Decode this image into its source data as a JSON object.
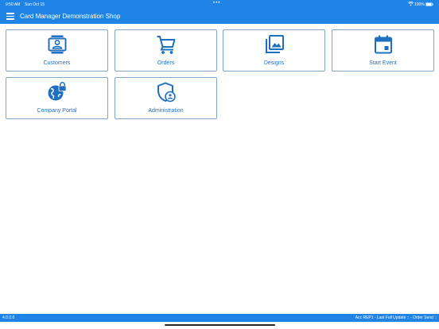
{
  "status_bar": {
    "time": "9:50 AM",
    "date": "Sun Oct 15",
    "dots": "•••",
    "battery_pct": "100%"
  },
  "header": {
    "title": "Card Manager Demonstration Shop",
    "menu_icon": "hamburger-icon"
  },
  "tiles": [
    {
      "label": "Customers",
      "icon": "contact-card-icon"
    },
    {
      "label": "Orders",
      "icon": "shopping-cart-icon"
    },
    {
      "label": "Designs",
      "icon": "image-gallery-icon"
    },
    {
      "label": "Start Event",
      "icon": "calendar-icon"
    },
    {
      "label": "Company Portal",
      "icon": "globe-lock-icon"
    },
    {
      "label": "Administration",
      "icon": "shield-user-icon"
    }
  ],
  "footer": {
    "version": "4.0.0.0",
    "sync_status": "Acc REP1 - Last Full Update :: - Order Send ::"
  },
  "colors": {
    "primary": "#1f84e5",
    "tile_border": "#7fa6c9",
    "tile_text": "#1f6fbf"
  }
}
